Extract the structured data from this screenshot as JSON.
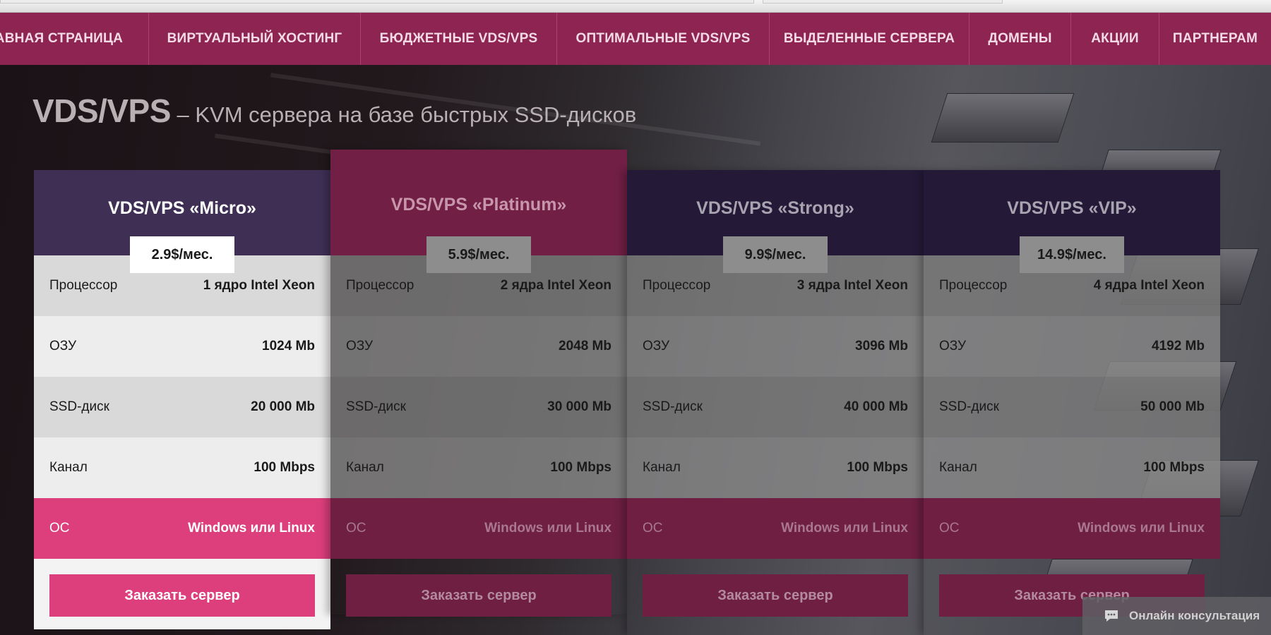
{
  "nav": {
    "items": [
      {
        "label": "Главная страница"
      },
      {
        "label": "Виртуальный хостинг"
      },
      {
        "label": "Бюджетные VDS/VPS"
      },
      {
        "label": "Оптимальные VDS/VPS"
      },
      {
        "label": "Выделенные сервера"
      },
      {
        "label": "Домены"
      },
      {
        "label": "Акции"
      },
      {
        "label": "Партнерам"
      }
    ]
  },
  "header": {
    "title": "VDS/VPS",
    "subtitle": " – KVM сервера на базе быстрых SSD-дисков"
  },
  "plans": [
    {
      "name": "VDS/VPS «Micro»",
      "price": "2.9$/мес.",
      "rows": [
        {
          "label": "Процессор",
          "value": "1 ядро Intel Xeon"
        },
        {
          "label": "ОЗУ",
          "value": "1024 Mb"
        },
        {
          "label": "SSD-диск",
          "value": "20 000 Mb"
        },
        {
          "label": "Канал",
          "value": "100 Mbps"
        },
        {
          "label": "ОС",
          "value": "Windows или Linux"
        }
      ],
      "button": "Заказать сервер"
    },
    {
      "name": "VDS/VPS «Platinum»",
      "price": "5.9$/мес.",
      "rows": [
        {
          "label": "Процессор",
          "value": "2 ядра Intel Xeon"
        },
        {
          "label": "ОЗУ",
          "value": "2048 Mb"
        },
        {
          "label": "SSD-диск",
          "value": "30 000 Mb"
        },
        {
          "label": "Канал",
          "value": "100 Mbps"
        },
        {
          "label": "ОС",
          "value": "Windows или Linux"
        }
      ],
      "button": "Заказать сервер"
    },
    {
      "name": "VDS/VPS «Strong»",
      "price": "9.9$/мес.",
      "rows": [
        {
          "label": "Процессор",
          "value": "3 ядра Intel Xeon"
        },
        {
          "label": "ОЗУ",
          "value": "3096 Mb"
        },
        {
          "label": "SSD-диск",
          "value": "40 000 Mb"
        },
        {
          "label": "Канал",
          "value": "100 Mbps"
        },
        {
          "label": "ОС",
          "value": "Windows или Linux"
        }
      ],
      "button": "Заказать сервер"
    },
    {
      "name": "VDS/VPS «VIP»",
      "price": "14.9$/мес.",
      "rows": [
        {
          "label": "Процессор",
          "value": "4 ядра Intel Xeon"
        },
        {
          "label": "ОЗУ",
          "value": "4192 Mb"
        },
        {
          "label": "SSD-диск",
          "value": "50 000 Mb"
        },
        {
          "label": "Канал",
          "value": "100 Mbps"
        },
        {
          "label": "ОС",
          "value": "Windows или Linux"
        }
      ],
      "button": "Заказать сервер"
    }
  ],
  "chat": {
    "label": "Онлайн консультация",
    "icon": "chat-bubble-icon"
  },
  "colors": {
    "nav": "#8e2452",
    "accent": "#dc3f7c",
    "active_head": "#3f2f55",
    "featured_head": "#711f45"
  }
}
